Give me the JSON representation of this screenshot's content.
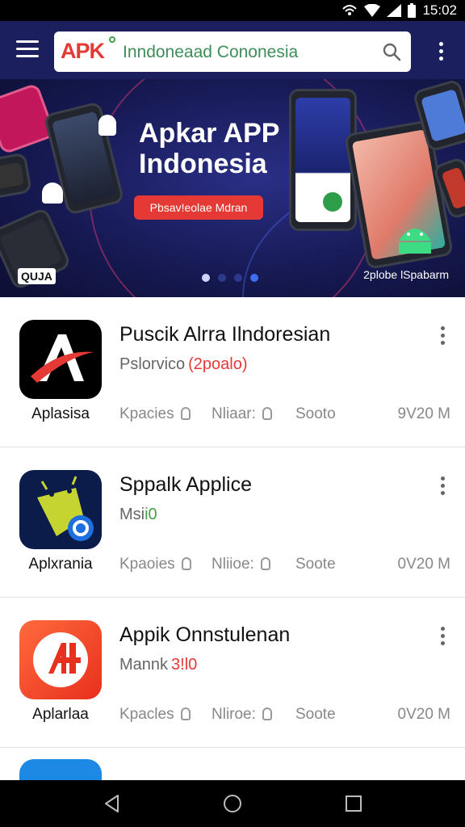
{
  "status_bar": {
    "time": "15:02"
  },
  "app_bar": {
    "brand": "APK",
    "search_text": "Inndoneaad Cononesia"
  },
  "banner": {
    "title": "Apkar APP Indonesia",
    "cta": "Pbsav!eolae Mdran",
    "logo": "QUJA",
    "caption": "2plobe  lSpabarm",
    "slide_count": 4,
    "active_slide": 1
  },
  "apps": [
    {
      "title": "Puscik Alrra Ilndoresian",
      "subtitle": "Pslorvico",
      "tag": "(2poalo)",
      "icon_label": "Aplasisa",
      "meta1": "Kpacies",
      "meta2": "Nliaar:",
      "meta3": "Sooto",
      "size": "9V20 M",
      "icon_color": "#000000",
      "tag_color": "#e53935"
    },
    {
      "title": "Sppalk Applice",
      "subtitle": "Msi",
      "tag": "i0",
      "icon_label": "Aplxrania",
      "meta1": "Kpaoies",
      "meta2": "Nliioe:",
      "meta3": "Soote",
      "size": "0V20 M",
      "icon_color": "#0b1b4a",
      "tag_color": "#43a047"
    },
    {
      "title": "Appik Onnstulenan",
      "subtitle": "Mannk",
      "tag": "3!l0",
      "icon_label": "Aplarlaa",
      "meta1": "Kpacles",
      "meta2": "Nliroe:",
      "meta3": "Soote",
      "size": "0V20 M",
      "icon_color": "#ef4a24",
      "tag_color": "#e53935"
    }
  ]
}
